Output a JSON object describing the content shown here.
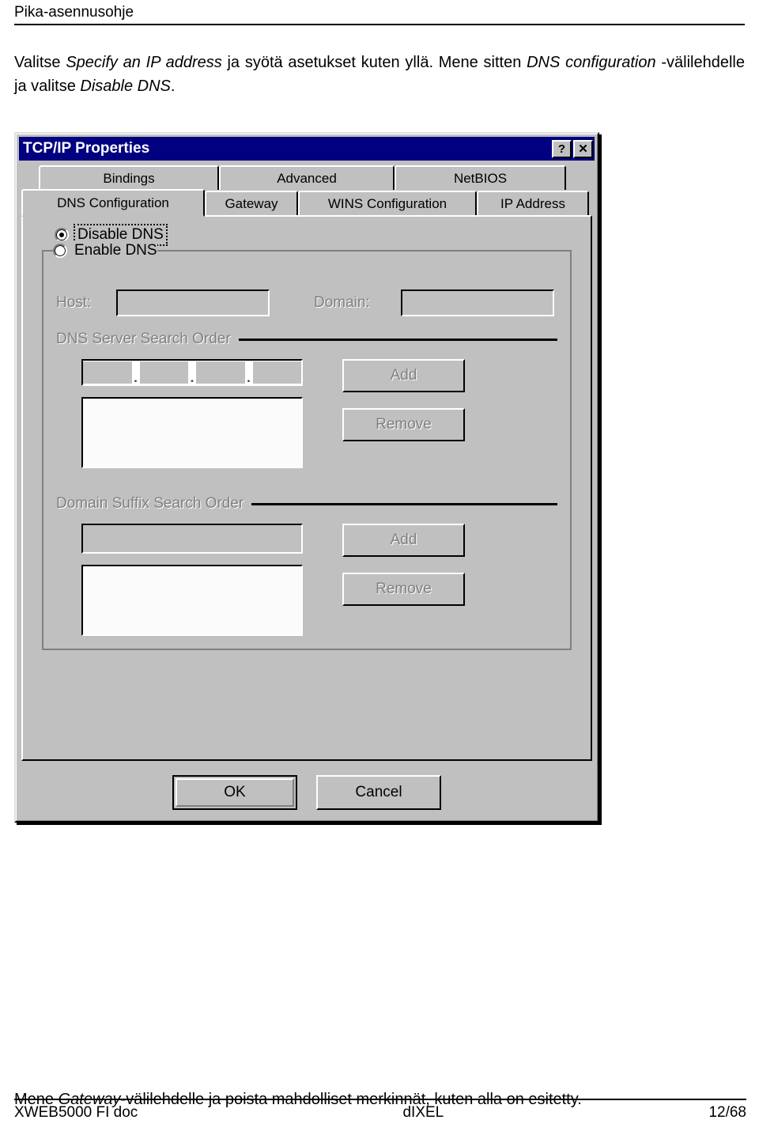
{
  "header": {
    "title": "Pika-asennusohje"
  },
  "intro": {
    "part1": "Valitse ",
    "em1": "Specify an IP address",
    "part2": " ja syötä asetukset kuten yllä. Mene sitten ",
    "em2": "DNS configuration",
    "part3": " -välilehdelle ja valitse ",
    "em3": "Disable DNS",
    "part4": "."
  },
  "dialog": {
    "title": "TCP/IP Properties",
    "help_button": "?",
    "close_button": "✕",
    "tabs_row1": [
      {
        "label": "Bindings",
        "active": false
      },
      {
        "label": "Advanced",
        "active": false
      },
      {
        "label": "NetBIOS",
        "active": false
      }
    ],
    "tabs_row2": [
      {
        "label": "DNS Configuration",
        "active": true
      },
      {
        "label": "Gateway",
        "active": false
      },
      {
        "label": "WINS Configuration",
        "active": false
      },
      {
        "label": "IP Address",
        "active": false
      }
    ],
    "radio_disable_dns": "Disable DNS",
    "radio_enable_dns": "Enable DNS",
    "selected_radio": "Disable DNS",
    "host_label": "Host:",
    "host_value": "",
    "domain_label": "Domain:",
    "domain_value": "",
    "dns_search_legend": "DNS Server Search Order",
    "dns_ip_octets": [
      "",
      "",
      "",
      ""
    ],
    "dns_ip_separator": ".",
    "dns_list_items": [],
    "dns_add_button": "Add",
    "dns_remove_button": "Remove",
    "suffix_search_legend": "Domain Suffix Search Order",
    "suffix_value": "",
    "suffix_list_items": [],
    "suffix_add_button": "Add",
    "suffix_remove_button": "Remove",
    "ok_button": "OK",
    "cancel_button": "Cancel"
  },
  "bottom_caption": {
    "part1": "Mene ",
    "em1": "Gateway",
    "part2": "-välilehdelle ja poista mahdolliset merkinnät, kuten alla on esitetty."
  },
  "footer": {
    "left": "XWEB5000 FI doc",
    "center": "dIXEL",
    "right": "12/68"
  },
  "colors": {
    "titlebar": "#000080",
    "face": "#c0c0c0",
    "disabled_text": "#808080"
  }
}
